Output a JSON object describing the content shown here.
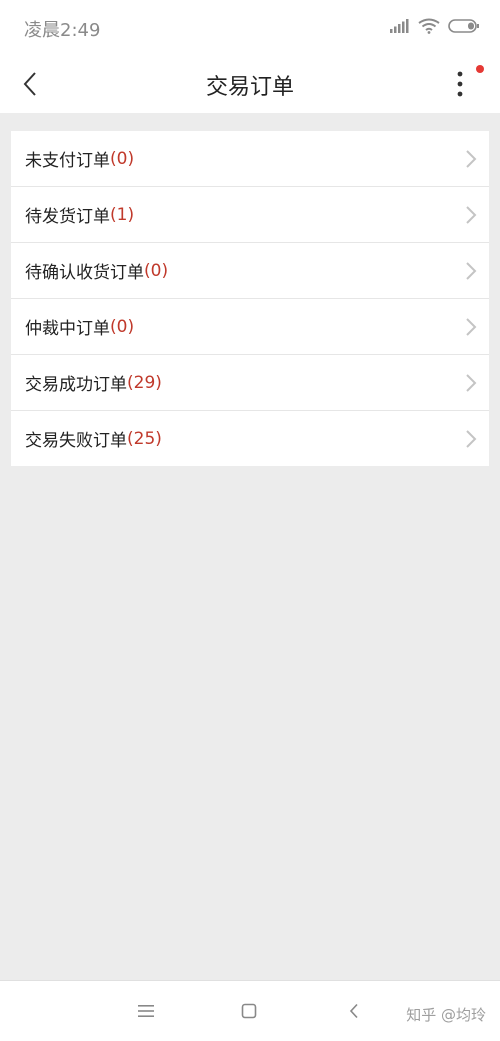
{
  "status_bar": {
    "time": "凌晨2:49",
    "icons": [
      "signal-icon",
      "wifi-icon",
      "battery-icon"
    ]
  },
  "header": {
    "title": "交易订单",
    "back_icon": "back-chevron-icon",
    "more_icon": "more-vertical-icon",
    "badge_color": "#e53935"
  },
  "orders": [
    {
      "label": "未支付订单",
      "count": "(0)"
    },
    {
      "label": "待发货订单",
      "count": "(1)"
    },
    {
      "label": "待确认收货订单",
      "count": "(0)"
    },
    {
      "label": "仲裁中订单",
      "count": "(0)"
    },
    {
      "label": "交易成功订单",
      "count": "(29)"
    },
    {
      "label": "交易失败订单",
      "count": "(25)"
    }
  ],
  "colors": {
    "count": "#c0392b",
    "background": "#ececec"
  },
  "nav_bar": {
    "icons": [
      "menu-icon",
      "home-icon",
      "back-icon"
    ]
  },
  "watermark": "知乎 @均玲"
}
